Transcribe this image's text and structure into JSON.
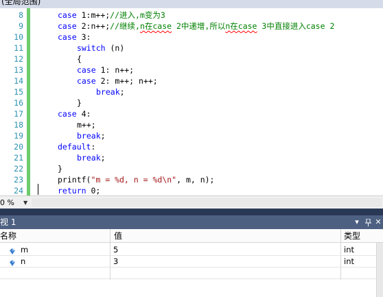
{
  "scope_label": "(全局范围)",
  "editor": {
    "lines": [
      {
        "num": "8"
      },
      {
        "num": "9"
      },
      {
        "num": "10"
      },
      {
        "num": "11"
      },
      {
        "num": "12"
      },
      {
        "num": "13"
      },
      {
        "num": "14"
      },
      {
        "num": "15"
      },
      {
        "num": "16"
      },
      {
        "num": "17"
      },
      {
        "num": "18"
      },
      {
        "num": "19"
      },
      {
        "num": "20"
      },
      {
        "num": "21"
      },
      {
        "num": "22"
      },
      {
        "num": "23"
      },
      {
        "num": "24"
      }
    ],
    "code": {
      "l8_kw": "case",
      "l8_rest": " 1:m++;",
      "l8_cm": "//进入,m变为3",
      "l9_kw": "case",
      "l9_rest": " 2:n++;",
      "l9_cm_a": "//继续,",
      "l9_cm_b": "n在case",
      "l9_cm_c": " 2中递增,所以",
      "l9_cm_d": "n在case",
      "l9_cm_e": " 3中直接进入case 2",
      "l10_kw": "case",
      "l10_rest": " 3:",
      "l11_kw": "switch",
      "l11_rest": " (n)",
      "l12": "{",
      "l13_kw": "case",
      "l13_rest": " 1: n++;",
      "l14_kw": "case",
      "l14_rest": " 2: m++; n++;",
      "l15_kw": "break",
      "l15_rest": ";",
      "l16": "}",
      "l17_kw": "case",
      "l17_rest": " 4:",
      "l18": "m++;",
      "l19_kw": "break",
      "l19_rest": ";",
      "l20_kw": "default",
      "l20_rest": ":",
      "l21_kw": "break",
      "l21_rest": ";",
      "l22": "}",
      "l23_a": "printf(",
      "l23_str": "\"m = %d, n = %d\\n\"",
      "l23_b": ", m, n);",
      "l24_kw": "return",
      "l24_rest": " 0;"
    }
  },
  "zoom": {
    "value": "0 %"
  },
  "watch": {
    "title": "视 1",
    "buttons": {
      "dropdown": "▾",
      "pin": "ᛘ",
      "close": "✕"
    },
    "columns": {
      "name": "名称",
      "value": "值",
      "type": "类型"
    },
    "rows": [
      {
        "name": "m",
        "value": "5",
        "type": "int"
      },
      {
        "name": "n",
        "value": "3",
        "type": "int"
      }
    ]
  },
  "colors": {
    "line_numbers": "#2b91af",
    "keyword": "#0000ff",
    "comment": "#008000",
    "string": "#a31515",
    "change_bar": "#6ccc6c",
    "watch_title_bg": "#4d6082"
  }
}
